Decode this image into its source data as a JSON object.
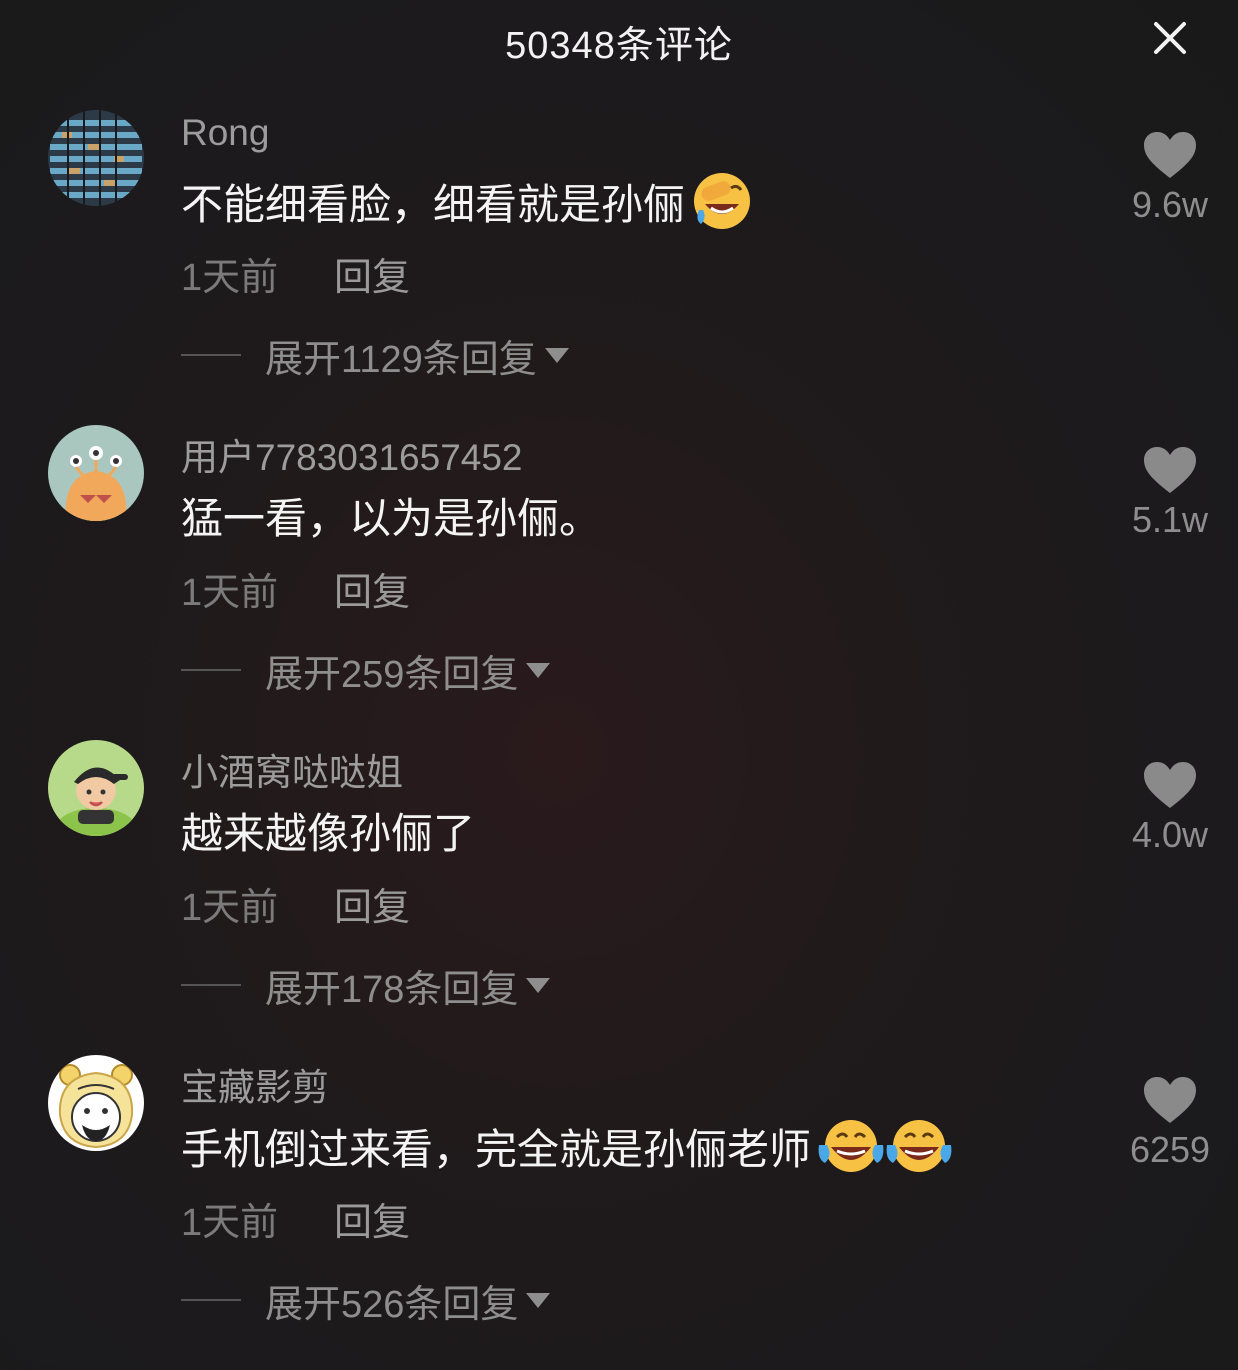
{
  "header": {
    "title": "50348条评论"
  },
  "comments": [
    {
      "username": "Rong",
      "text": "不能细看脸，细看就是孙俪",
      "emoji_count": 1,
      "emoji": "face-with-hand-over-eye-laugh-icon",
      "time": "1天前",
      "reply": "回复",
      "expand": "展开1129条回复",
      "likes": "9.6w"
    },
    {
      "username": "用户7783031657452",
      "text": "猛一看，以为是孙俪。",
      "emoji_count": 0,
      "time": "1天前",
      "reply": "回复",
      "expand": "展开259条回复",
      "likes": "5.1w"
    },
    {
      "username": "小酒窝哒哒姐",
      "text": "越来越像孙俪了",
      "emoji_count": 0,
      "time": "1天前",
      "reply": "回复",
      "expand": "展开178条回复",
      "likes": "4.0w"
    },
    {
      "username": "宝藏影剪",
      "text": "手机倒过来看，完全就是孙俪老师",
      "emoji_count": 2,
      "emoji": "tears-of-joy-icon",
      "time": "1天前",
      "reply": "回复",
      "expand": "展开526条回复",
      "likes": "6259"
    }
  ],
  "colors": {
    "background": "#1e1a1b",
    "text": "#f4f4f4",
    "muted": "#8e8e8e"
  }
}
